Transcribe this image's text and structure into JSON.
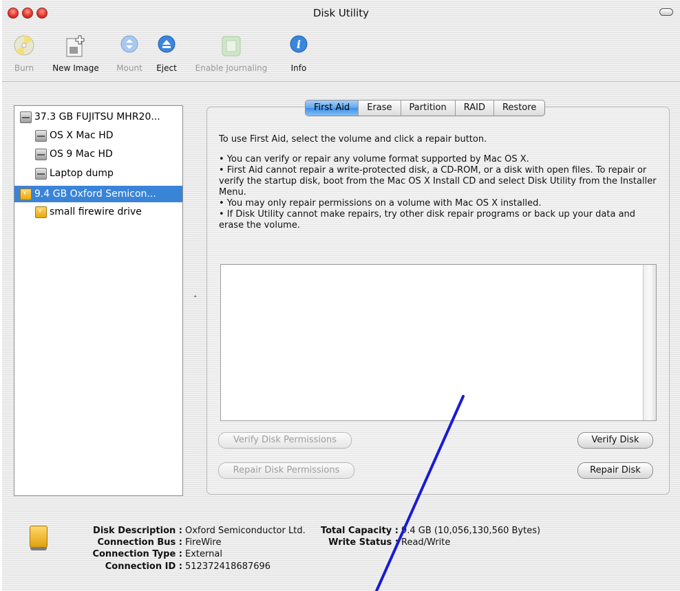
{
  "window": {
    "title": "Disk Utility"
  },
  "toolbar": {
    "items": [
      {
        "label": "Burn",
        "icon": "burn-icon",
        "enabled": false
      },
      {
        "label": "New Image",
        "icon": "new-image-icon",
        "enabled": true
      },
      {
        "label": "Mount",
        "icon": "mount-icon",
        "enabled": false
      },
      {
        "label": "Eject",
        "icon": "eject-icon",
        "enabled": true
      },
      {
        "label": "Enable Journaling",
        "icon": "journaling-icon",
        "enabled": false
      },
      {
        "label": "Info",
        "icon": "info-icon",
        "enabled": true
      }
    ]
  },
  "disks": [
    {
      "name": "37.3 GB FUJITSU MHR20...",
      "icon": "hard-disk-icon",
      "level": 0,
      "selected": false
    },
    {
      "name": "OS X Mac HD",
      "icon": "hard-disk-icon",
      "level": 1,
      "selected": false
    },
    {
      "name": "OS 9 Mac HD",
      "icon": "hard-disk-icon",
      "level": 1,
      "selected": false
    },
    {
      "name": "Laptop dump",
      "icon": "hard-disk-icon",
      "level": 1,
      "selected": false
    },
    {
      "name": "9.4 GB Oxford Semicon...",
      "icon": "firewire-disk-icon",
      "level": 0,
      "selected": true
    },
    {
      "name": "small firewire drive",
      "icon": "firewire-disk-icon",
      "level": 1,
      "selected": false
    }
  ],
  "tabs": [
    "First Aid",
    "Erase",
    "Partition",
    "RAID",
    "Restore"
  ],
  "active_tab": "First Aid",
  "first_aid": {
    "intro": "To use First Aid, select the volume and click a repair button.",
    "bullets": [
      "• You can verify or repair any volume format supported by Mac OS X.",
      "• First Aid cannot repair a write-protected disk, a CD-ROM, or a disk with open files. To repair or verify the startup disk, boot from the Mac OS X Install CD and select Disk Utility from the Installer Menu.",
      "• You may only repair permissions on a volume with Mac OS X installed.",
      "• If Disk Utility cannot make repairs, try other disk repair programs or back up your data and erase the volume."
    ],
    "buttons": {
      "verify_permissions": "Verify Disk Permissions",
      "repair_permissions": "Repair Disk Permissions",
      "verify_disk": "Verify Disk",
      "repair_disk": "Repair Disk"
    }
  },
  "info": {
    "disk_description_label": "Disk Description :",
    "disk_description": "Oxford Semiconductor Ltd.",
    "connection_bus_label": "Connection Bus :",
    "connection_bus": "FireWire",
    "connection_type_label": "Connection Type :",
    "connection_type": "External",
    "connection_id_label": "Connection ID :",
    "connection_id": "512372418687696",
    "total_capacity_label": "Total Capacity :",
    "total_capacity": "9.4 GB (10,056,130,560 Bytes)",
    "write_status_label": "Write Status :",
    "write_status": "Read/Write"
  },
  "colors": {
    "selection": "#3a84d8",
    "annotation_stroke": "#1a1ad6",
    "close_light": "#e7342b"
  }
}
